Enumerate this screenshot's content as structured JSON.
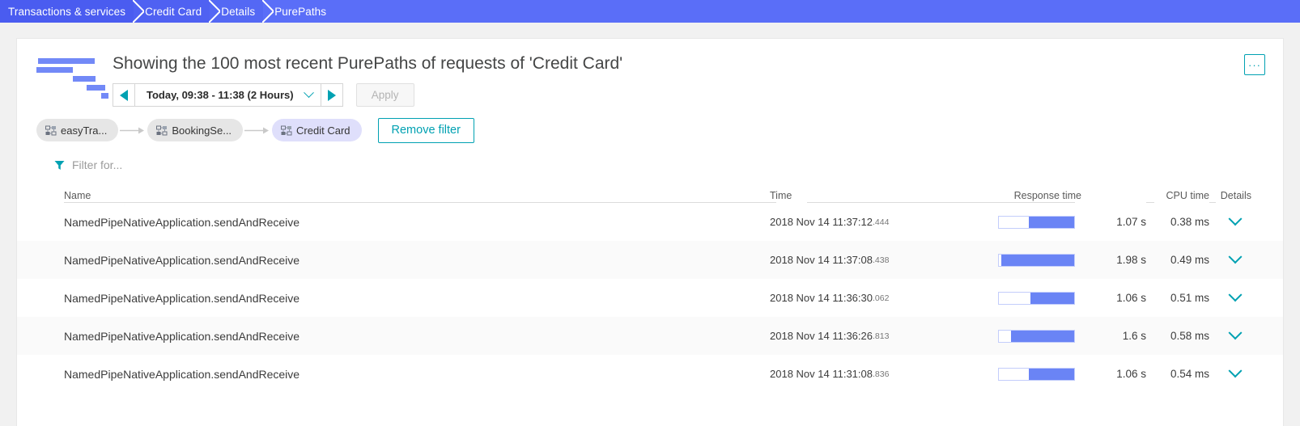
{
  "breadcrumb": {
    "items": [
      {
        "label": "Transactions & services"
      },
      {
        "label": "Credit Card"
      },
      {
        "label": "Details"
      },
      {
        "label": "PurePaths"
      }
    ]
  },
  "header": {
    "title": "Showing the 100 most recent PurePaths of requests of 'Credit Card'",
    "more_label": "···",
    "icon": "purepaths-waterfall-icon"
  },
  "timeframe": {
    "prev_icon": "triangle-left-icon",
    "next_icon": "triangle-right-icon",
    "value": "Today, 09:38 - 11:38 (2 Hours)",
    "dropdown_icon": "chevron-down-icon",
    "apply_label": "Apply"
  },
  "filter_chips": {
    "chips": [
      {
        "label": "easyTra...",
        "icon": "service-icon",
        "active": false
      },
      {
        "label": "BookingSe...",
        "icon": "service-icon",
        "active": false
      },
      {
        "label": "Credit Card",
        "icon": "service-icon",
        "active": true
      }
    ],
    "remove_label": "Remove filter"
  },
  "filter_for": {
    "icon": "funnel-icon",
    "placeholder": "Filter for..."
  },
  "table": {
    "columns": {
      "name": "Name",
      "time": "Time",
      "response_time": "Response time",
      "cpu_time": "CPU time",
      "details": "Details"
    },
    "rows": [
      {
        "name": "NamedPipeNativeApplication.sendAndReceive",
        "time": "2018 Nov 14 11:37:12",
        "time_ms": ".444",
        "bar_start_pct": 40,
        "bar_end_pct": 100,
        "response_time": "1.07 s",
        "cpu_time": "0.38 ms",
        "details_icon": "chevron-down-icon"
      },
      {
        "name": "NamedPipeNativeApplication.sendAndReceive",
        "time": "2018 Nov 14 11:37:08",
        "time_ms": ".438",
        "bar_start_pct": 3,
        "bar_end_pct": 100,
        "response_time": "1.98 s",
        "cpu_time": "0.49 ms",
        "details_icon": "chevron-down-icon"
      },
      {
        "name": "NamedPipeNativeApplication.sendAndReceive",
        "time": "2018 Nov 14 11:36:30",
        "time_ms": ".062",
        "bar_start_pct": 42,
        "bar_end_pct": 100,
        "response_time": "1.06 s",
        "cpu_time": "0.51 ms",
        "details_icon": "chevron-down-icon"
      },
      {
        "name": "NamedPipeNativeApplication.sendAndReceive",
        "time": "2018 Nov 14 11:36:26",
        "time_ms": ".813",
        "bar_start_pct": 16,
        "bar_end_pct": 100,
        "response_time": "1.6 s",
        "cpu_time": "0.58 ms",
        "details_icon": "chevron-down-icon"
      },
      {
        "name": "NamedPipeNativeApplication.sendAndReceive",
        "time": "2018 Nov 14 11:31:08",
        "time_ms": ".836",
        "bar_start_pct": 40,
        "bar_end_pct": 100,
        "response_time": "1.06 s",
        "cpu_time": "0.54 ms",
        "details_icon": "chevron-down-icon"
      }
    ]
  },
  "colors": {
    "breadcrumb_bg": "#4a5cf0",
    "accent_teal": "#00a1b2",
    "bar_blue": "#6a84f5",
    "page_bg": "#f1f1f1",
    "chip_active_bg": "#dfdffb"
  }
}
